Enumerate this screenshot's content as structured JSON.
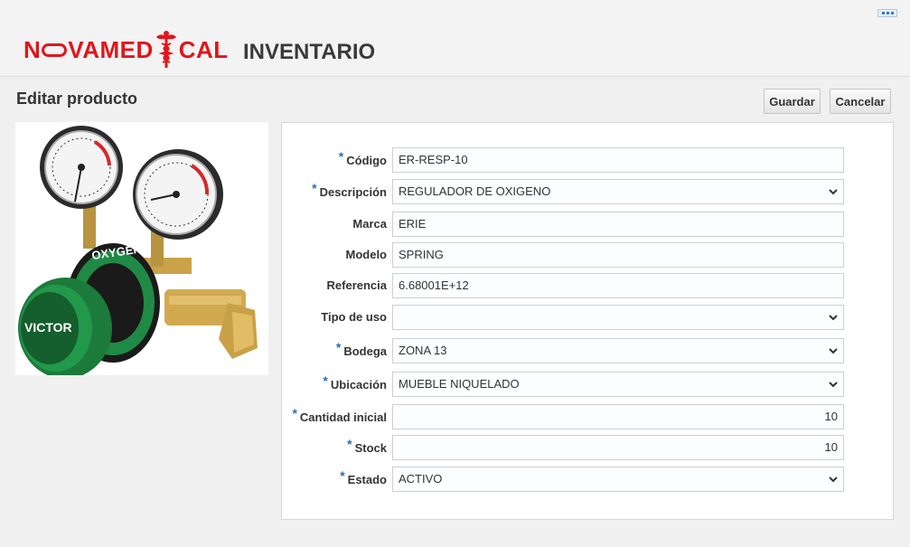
{
  "header": {
    "logo_part1": "N",
    "logo_part2": "VAMED",
    "logo_part3": "CAL",
    "app_title": "INVENTARIO"
  },
  "page": {
    "title": "Editar producto",
    "save_label": "Guardar",
    "cancel_label": "Cancelar"
  },
  "product_image": {
    "brand_text": "VICTOR",
    "gas_text": "OXYGEN"
  },
  "form": {
    "fields": [
      {
        "label": "Código",
        "required": true,
        "value": "ER-RESP-10",
        "type": "text"
      },
      {
        "label": "Descripción",
        "required": true,
        "value": "REGULADOR DE OXIGENO",
        "type": "select"
      },
      {
        "label": "Marca",
        "required": false,
        "value": "ERIE",
        "type": "text"
      },
      {
        "label": "Modelo",
        "required": false,
        "value": "SPRING",
        "type": "text"
      },
      {
        "label": "Referencia",
        "required": false,
        "value": "6.68001E+12",
        "type": "text"
      },
      {
        "label": "Tipo de uso",
        "required": false,
        "value": "",
        "type": "select"
      },
      {
        "label": "Bodega",
        "required": true,
        "value": "ZONA 13",
        "type": "select"
      },
      {
        "label": "Ubicación",
        "required": true,
        "value": "MUEBLE NIQUELADO",
        "type": "select"
      },
      {
        "label": "Cantidad inicial",
        "required": true,
        "value": "10",
        "type": "number"
      },
      {
        "label": "Stock",
        "required": true,
        "value": "10",
        "type": "number"
      },
      {
        "label": "Estado",
        "required": true,
        "value": "ACTIVO",
        "type": "select"
      }
    ],
    "required_marker": "*"
  },
  "colors": {
    "brand_red": "#e0161b",
    "required_blue": "#2a6fb6",
    "gauge_green": "#1f8a45"
  }
}
